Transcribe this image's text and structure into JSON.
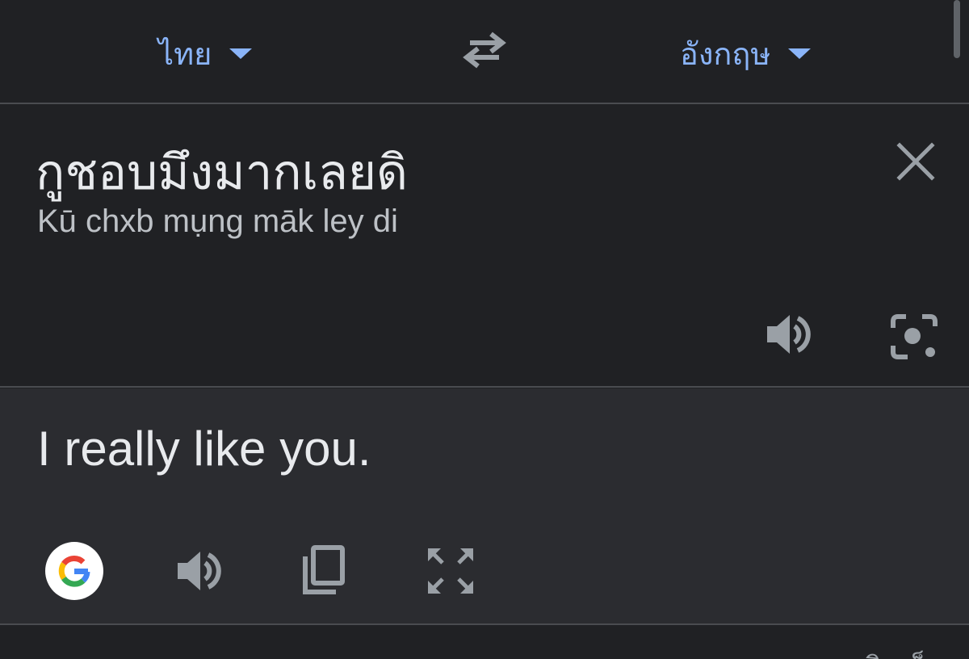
{
  "lang_bar": {
    "source_language": "ไทย",
    "target_language": "อังกฤษ",
    "swap_icon": "swap-arrows-icon",
    "accent_color": "#8ab4f8"
  },
  "source": {
    "text": "กูชอบมึงมากเลยดิ",
    "transliteration": "Kū chxb mụng māk ley di",
    "close_icon": "close-icon",
    "speaker_icon": "speaker-icon",
    "camera_icon": "camera-lens-icon"
  },
  "result": {
    "text": "I really like you.",
    "google_icon": "google-g-icon",
    "speaker_icon": "speaker-icon",
    "copy_icon": "copy-icon",
    "fullscreen_icon": "fullscreen-icon"
  },
  "bottom": {
    "partial_label": "ความคิดเห็น"
  }
}
